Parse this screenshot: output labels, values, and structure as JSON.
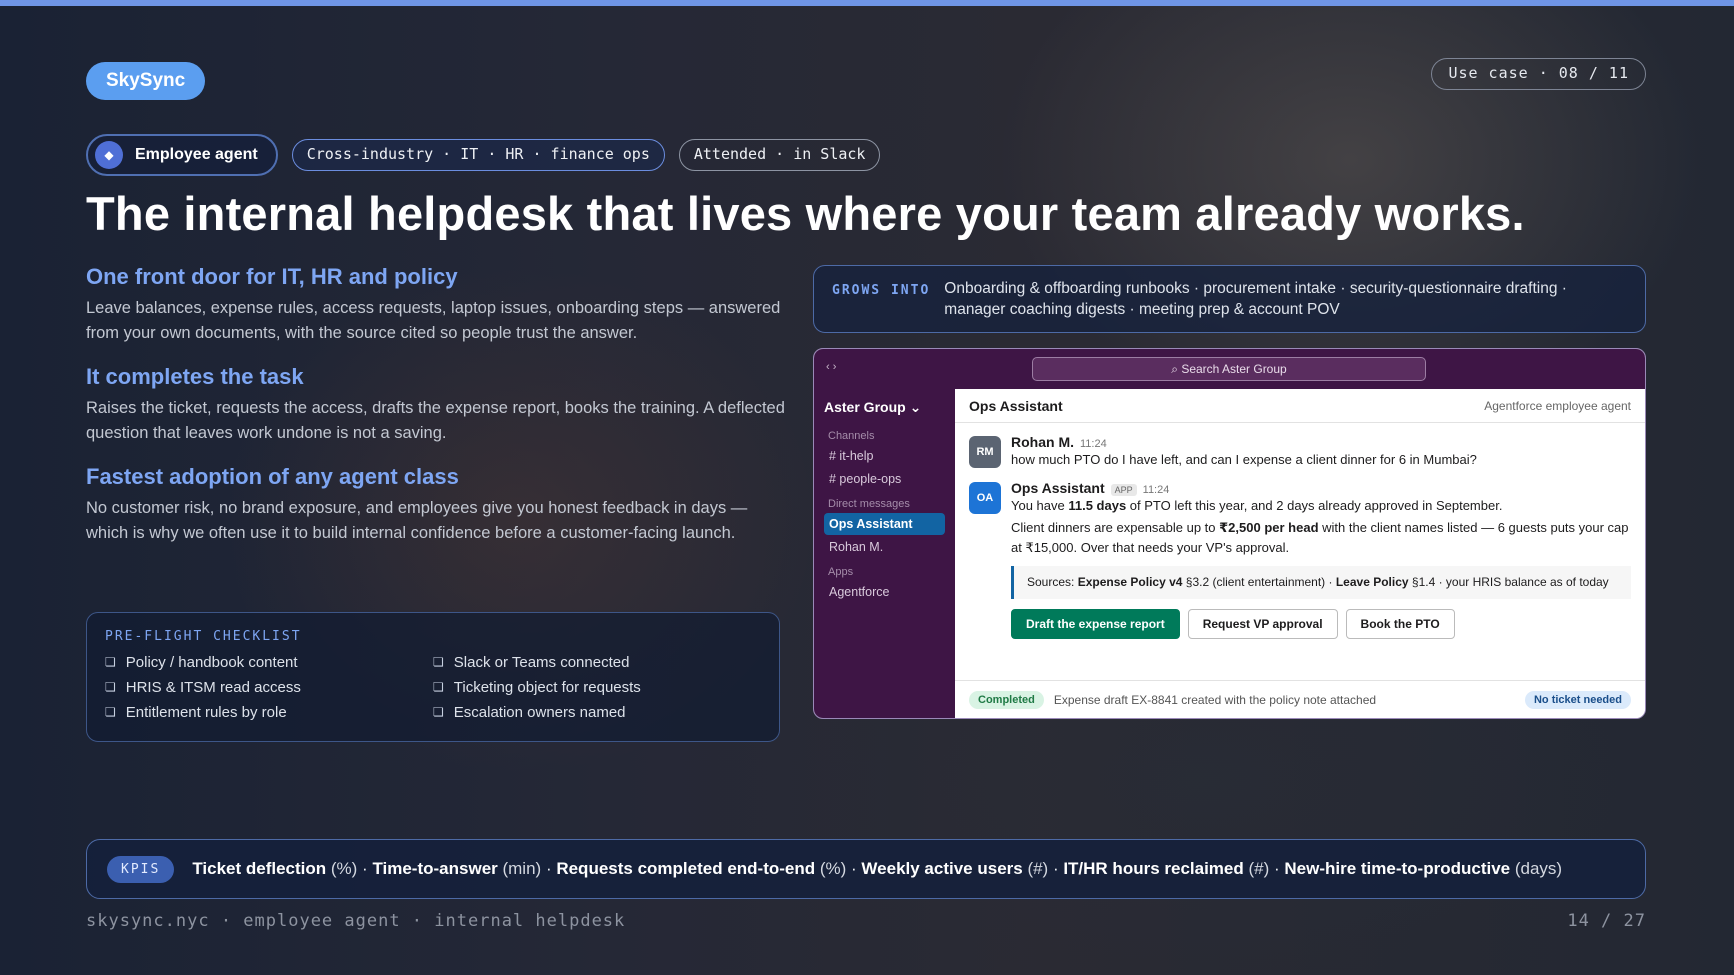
{
  "brand": "SkySync",
  "use_case": "Use case · 08 / 11",
  "tags": {
    "agent_icon": "◆",
    "agent": "Employee agent",
    "industry": "Cross-industry · IT · HR · finance ops",
    "mode": "Attended · in Slack"
  },
  "headline": "The internal helpdesk that lives where your team already works.",
  "sections": [
    {
      "title": "One front door for IT, HR and policy",
      "body": "Leave balances, expense rules, access requests, laptop issues, onboarding steps — answered from your own documents, with the source cited so people trust the answer."
    },
    {
      "title": "It completes the task",
      "body": "Raises the ticket, requests the access, drafts the expense report, books the training. A deflected question that leaves work undone is not a saving."
    },
    {
      "title": "Fastest adoption of any agent class",
      "body": "No customer risk, no brand exposure, and employees give you honest feedback in days — which is why we often use it to build internal confidence before a customer-facing launch."
    }
  ],
  "checklist": {
    "title": "PRE-FLIGHT CHECKLIST",
    "box_glyph": "❏",
    "items": [
      "Policy / handbook content",
      "Slack or Teams connected",
      "HRIS & ITSM read access",
      "Ticketing object for requests",
      "Entitlement rules by role",
      "Escalation owners named"
    ]
  },
  "grows": {
    "label": "GROWS INTO",
    "text": "Onboarding & offboarding runbooks · procurement intake · security-questionnaire drafting · manager coaching digests · meeting prep & account POV"
  },
  "slack": {
    "nav_arrows": "‹ ›",
    "search": "⌕ Search Aster Group",
    "workspace": "Aster Group ⌄",
    "channels_label": "Channels",
    "channels": [
      "# it-help",
      "# people-ops"
    ],
    "dm_label": "Direct messages",
    "dms": [
      "Ops Assistant",
      "Rohan M."
    ],
    "apps_label": "Apps",
    "apps": [
      "Agentforce"
    ],
    "header_name": "Ops Assistant",
    "header_sub": "Agentforce employee agent",
    "msg1": {
      "initials": "RM",
      "name": "Rohan M.",
      "time": "11:24",
      "text": "how much PTO do I have left, and can I expense a client dinner for 6 in Mumbai?"
    },
    "msg2": {
      "initials": "OA",
      "name": "Ops Assistant",
      "app": "APP",
      "time": "11:24",
      "l1a": "You have ",
      "l1b": "11.5 days",
      "l1c": " of PTO left this year, and 2 days already approved in September.",
      "l2a": "Client dinners are expensable up to ",
      "l2b": "₹2,500 per head",
      "l2c": " with the client names listed — 6 guests puts your cap at ₹15,000. Over that needs your VP's approval.",
      "src_a": "Sources: ",
      "src_b": "Expense Policy v4",
      "src_c": " §3.2 (client entertainment) · ",
      "src_d": "Leave Policy",
      "src_e": " §1.4 · your HRIS balance as of today"
    },
    "buttons": [
      "Draft the expense report",
      "Request VP approval",
      "Book the PTO"
    ],
    "footer_status": "Completed",
    "footer_text": "Expense draft EX-8841 created with the policy note attached",
    "footer_badge": "No ticket needed"
  },
  "kpis": {
    "label": "KPIS",
    "items": [
      {
        "name": "Ticket deflection",
        "unit": " (%)"
      },
      {
        "name": "Time-to-answer",
        "unit": " (min)"
      },
      {
        "name": "Requests completed end-to-end",
        "unit": " (%)"
      },
      {
        "name": "Weekly active users",
        "unit": " (#)"
      },
      {
        "name": "IT/HR hours reclaimed",
        "unit": " (#)"
      },
      {
        "name": "New-hire time-to-productive",
        "unit": " (days)"
      }
    ],
    "separator": " · "
  },
  "footer": {
    "left": "skysync.nyc · employee agent · internal helpdesk",
    "right": "14 / 27"
  },
  "colors": {
    "accent": "#7ea6f3",
    "brand": "#5b9ef0",
    "slack_sidebar": "#3e1545",
    "slack_primary": "#007a5a"
  }
}
